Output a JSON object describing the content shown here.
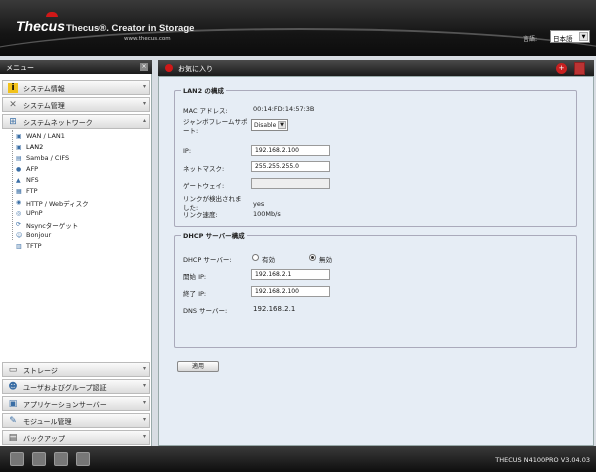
{
  "header": {
    "logo": "Thecus",
    "tagline": "Thecus®. Creator in Storage",
    "url": "www.thecus.com",
    "language_label": "言語:",
    "language_value": "日本語"
  },
  "sidebar": {
    "title": "メニュー",
    "close": "×",
    "sections_top": [
      {
        "label": "システム情報",
        "icon": "info-icon"
      },
      {
        "label": "システム管理",
        "icon": "tools-icon"
      },
      {
        "label": "システムネットワーク",
        "icon": "network-icon"
      }
    ],
    "items": [
      "WAN / LAN1",
      "LAN2",
      "Samba / CIFS",
      "AFP",
      "NFS",
      "FTP",
      "HTTP / Webディスク",
      "UPnP",
      "Nsyncターゲット",
      "Bonjour",
      "TFTP"
    ],
    "sections_bottom": [
      {
        "label": "ストレージ",
        "icon": "storage-icon"
      },
      {
        "label": "ユーザおよびグループ認証",
        "icon": "users-icon"
      },
      {
        "label": "アプリケーションサーバー",
        "icon": "application-icon"
      },
      {
        "label": "モジュール管理",
        "icon": "module-icon"
      },
      {
        "label": "バックアップ",
        "icon": "backup-icon"
      }
    ]
  },
  "favorites": {
    "title": "お気に入り"
  },
  "lan2": {
    "title": "LAN2 の構成",
    "mac_label": "MAC アドレス:",
    "mac_value": "00:14:FD:14:57:3B",
    "jumbo_label": "ジャンボフレームサポート:",
    "jumbo_value": "Disable",
    "ip_label": "IP:",
    "ip_value": "192.168.2.100",
    "mask_label": "ネットマスク:",
    "mask_value": "255.255.255.0",
    "gateway_label": "ゲートウェイ:",
    "gateway_value": "",
    "link_label": "リンクが検出されました:",
    "link_value": "yes",
    "speed_label": "リンク速度:",
    "speed_value": "100Mb/s"
  },
  "dhcp": {
    "title": "DHCP サーバー構成",
    "server_label": "DHCP サーバー:",
    "enable_label": "有効",
    "disable_label": "無効",
    "start_label": "開始 IP:",
    "start_value": "192.168.2.1",
    "end_label": "終了 IP:",
    "end_value": "192.168.2.100",
    "dns_label": "DNS サーバー:",
    "dns_value": "192.168.2.1"
  },
  "apply_label": "適用",
  "footer": {
    "version": "THECUS N4100PRO V3.04.03"
  }
}
